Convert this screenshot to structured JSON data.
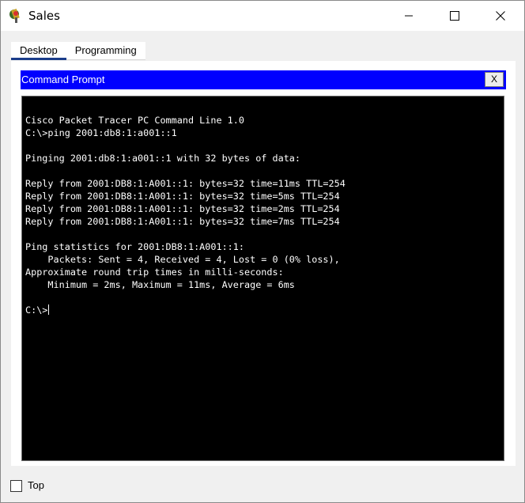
{
  "window": {
    "title": "Sales"
  },
  "tabs": [
    {
      "label": "Desktop",
      "active": true
    },
    {
      "label": "Programming",
      "active": false
    }
  ],
  "command_prompt": {
    "title": "Command Prompt",
    "close_label": "X",
    "lines": [
      "Cisco Packet Tracer PC Command Line 1.0",
      "C:\\>ping 2001:db8:1:a001::1",
      "",
      "Pinging 2001:db8:1:a001::1 with 32 bytes of data:",
      "",
      "Reply from 2001:DB8:1:A001::1: bytes=32 time=11ms TTL=254",
      "Reply from 2001:DB8:1:A001::1: bytes=32 time=5ms TTL=254",
      "Reply from 2001:DB8:1:A001::1: bytes=32 time=2ms TTL=254",
      "Reply from 2001:DB8:1:A001::1: bytes=32 time=7ms TTL=254",
      "",
      "Ping statistics for 2001:DB8:1:A001::1:",
      "    Packets: Sent = 4, Received = 4, Lost = 0 (0% loss),",
      "Approximate round trip times in milli-seconds:",
      "    Minimum = 2ms, Maximum = 11ms, Average = 6ms",
      ""
    ],
    "prompt": "C:\\>"
  },
  "footer": {
    "top_label": "Top",
    "top_checked": false
  }
}
